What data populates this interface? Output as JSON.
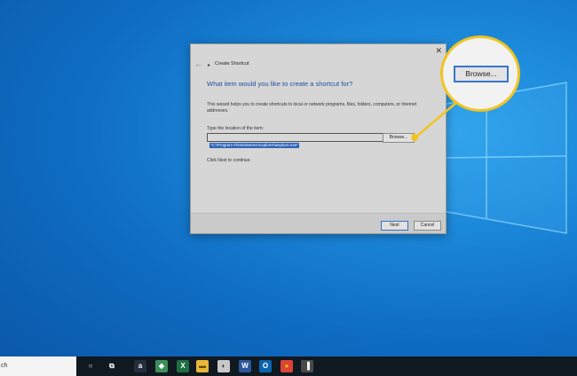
{
  "dialog": {
    "title": "Create Shortcut",
    "close_glyph": "✕",
    "back_glyph": "←",
    "heading": "What item would you like to create a shortcut for?",
    "description": "This wizard helps you to create shortcuts to local or network programs, files, folders, computers, or Internet addresses.",
    "location_label": "Type the location of the item:",
    "location_value": "\"C:\\Program Files\\Internet Explorer\\iexplore.exe\"",
    "browse_label": "Browse...",
    "continue_text": "Click Next to continue.",
    "next_label": "Next",
    "cancel_label": "Cancel"
  },
  "callout": {
    "browse_label": "Browse...",
    "color": "#f1c420"
  },
  "taskbar": {
    "search_text": "ch",
    "icons": [
      {
        "name": "cortana-icon",
        "glyph": "○"
      },
      {
        "name": "task-view-icon",
        "glyph": "⧉"
      },
      {
        "name": "amazon-icon",
        "glyph": "a"
      },
      {
        "name": "app-icon",
        "glyph": "◆"
      },
      {
        "name": "excel-icon",
        "glyph": "X"
      },
      {
        "name": "file-explorer-icon",
        "glyph": "▬"
      },
      {
        "name": "app-icon-2",
        "glyph": "◐"
      },
      {
        "name": "word-icon",
        "glyph": "W"
      },
      {
        "name": "outlook-icon",
        "glyph": "O"
      },
      {
        "name": "chrome-icon",
        "glyph": "●"
      },
      {
        "name": "app-icon-3",
        "glyph": "▐"
      }
    ]
  }
}
